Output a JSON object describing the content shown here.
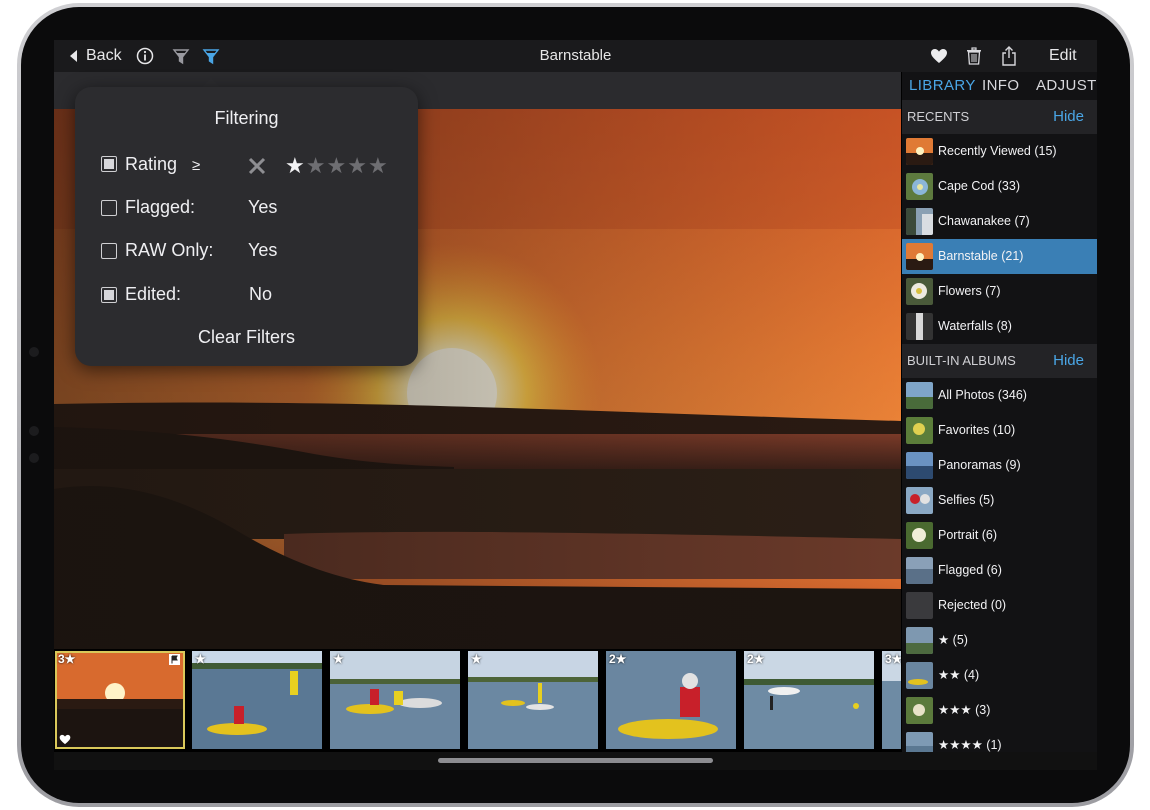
{
  "topbar": {
    "back_label": "Back",
    "title": "Barnstable",
    "edit_label": "Edit"
  },
  "sidebar": {
    "tabs": [
      "LIBRARY",
      "INFO",
      "ADJUST"
    ],
    "recents": {
      "header": "RECENTS",
      "hide_label": "Hide",
      "items": [
        {
          "label": "Recently Viewed (15)"
        },
        {
          "label": "Cape Cod (33)"
        },
        {
          "label": "Chawanakee (7)"
        },
        {
          "label": "Barnstable (21)",
          "selected": true
        },
        {
          "label": "Flowers (7)"
        },
        {
          "label": "Waterfalls (8)"
        }
      ]
    },
    "builtin": {
      "header": "BUILT-IN ALBUMS",
      "hide_label": "Hide",
      "items": [
        {
          "label": "All Photos (346)"
        },
        {
          "label": "Favorites (10)"
        },
        {
          "label": "Panoramas (9)"
        },
        {
          "label": "Selfies (5)"
        },
        {
          "label": "Portrait (6)"
        },
        {
          "label": "Flagged (6)"
        },
        {
          "label": "Rejected (0)"
        },
        {
          "label": "★ (5)"
        },
        {
          "label": "★★ (4)"
        },
        {
          "label": "★★★ (3)"
        },
        {
          "label": "★★★★ (1)"
        }
      ]
    }
  },
  "filter_popover": {
    "title": "Filtering",
    "rating": {
      "label": "Rating",
      "operator": "≥",
      "checked": true,
      "stars_selected": 1,
      "stars_total": 5
    },
    "flagged": {
      "label": "Flagged:",
      "value": "Yes",
      "checked": false
    },
    "raw_only": {
      "label": "RAW Only:",
      "value": "Yes",
      "checked": false
    },
    "edited": {
      "label": "Edited:",
      "value": "No",
      "checked": true
    },
    "clear_label": "Clear Filters"
  },
  "filmstrip": [
    {
      "badge": "3★",
      "selected": true,
      "flag": true,
      "heart": true
    },
    {
      "badge": "★"
    },
    {
      "badge": "★"
    },
    {
      "badge": "★"
    },
    {
      "badge": "2★"
    },
    {
      "badge": "2★"
    },
    {
      "badge": "3★"
    }
  ],
  "colors": {
    "accent": "#4aa6e6",
    "selected_row": "#3a7fb5",
    "thumb_selection": "#d9c85a"
  }
}
